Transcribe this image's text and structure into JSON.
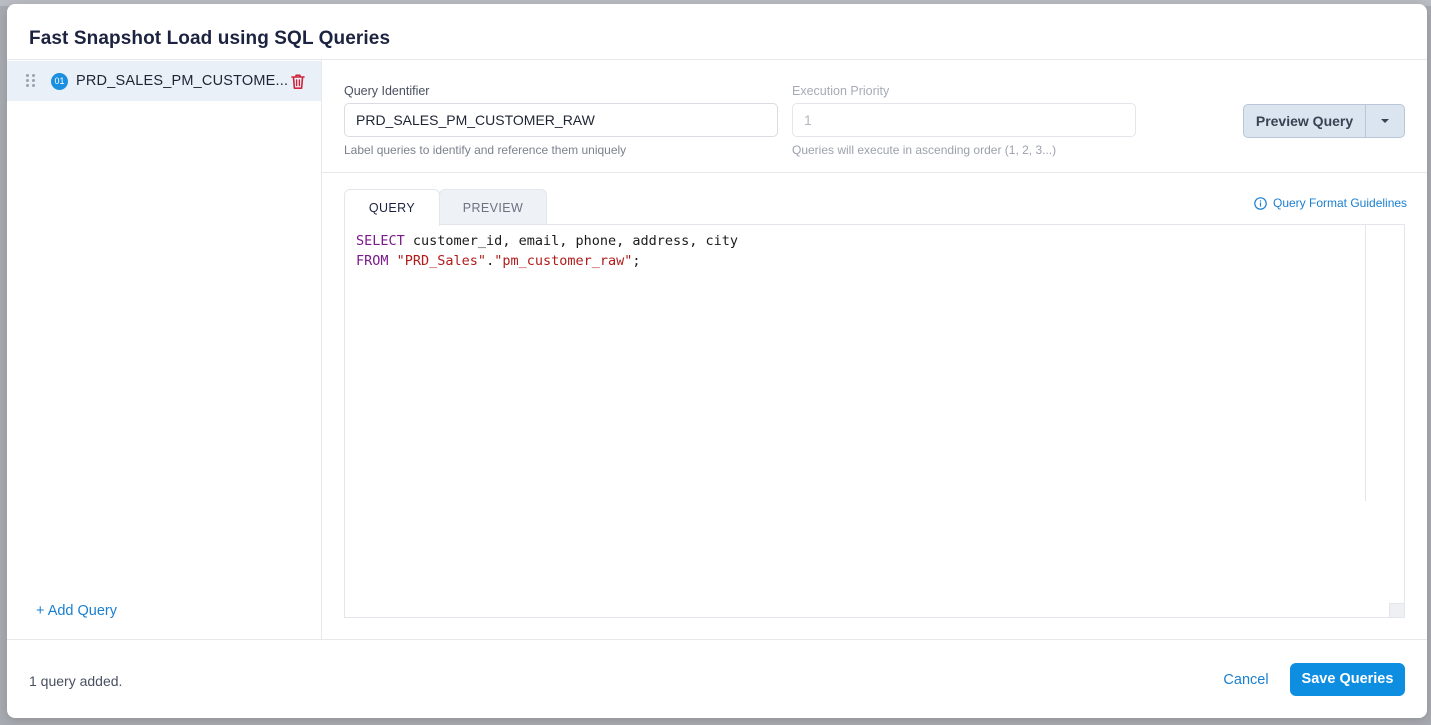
{
  "modal": {
    "title": "Fast Snapshot Load using SQL Queries"
  },
  "sidebar": {
    "items": [
      {
        "number": "01",
        "label": "PRD_SALES_PM_CUSTOME..."
      }
    ],
    "add_query_label": "+ Add Query"
  },
  "form": {
    "identifier_label": "Query Identifier",
    "identifier_value": "PRD_SALES_PM_CUSTOMER_RAW",
    "identifier_help": "Label queries to identify and reference them uniquely",
    "priority_label": "Execution Priority",
    "priority_value": "1",
    "priority_help": "Queries will execute in ascending order (1, 2, 3...)",
    "preview_button_label": "Preview Query"
  },
  "tabs": [
    {
      "label": "QUERY",
      "active": true
    },
    {
      "label": "PREVIEW",
      "active": false
    }
  ],
  "guidelines_link": "Query Format Guidelines",
  "editor": {
    "line1_kw": "SELECT",
    "line1_rest": " customer_id, email, phone, address, city",
    "line2_kw": "FROM",
    "line2_str1": "\"PRD_Sales\"",
    "line2_dot": ".",
    "line2_str2": "\"pm_customer_raw\"",
    "line2_end": ";"
  },
  "footer": {
    "status": "1 query added.",
    "cancel_label": "Cancel",
    "save_label": "Save Queries"
  },
  "colors": {
    "accent": "#1a7fd0",
    "primary_button": "#0e8ee0",
    "danger_icon": "#d0223a",
    "selected_item_bg": "#eaf0f8",
    "sql_keyword": "#7a1a8c",
    "sql_string": "#b11b1b"
  },
  "icons": {
    "drag": "drag-handle-icon",
    "delete": "trash-icon",
    "info": "info-icon",
    "dropdown": "caret-down-icon"
  }
}
